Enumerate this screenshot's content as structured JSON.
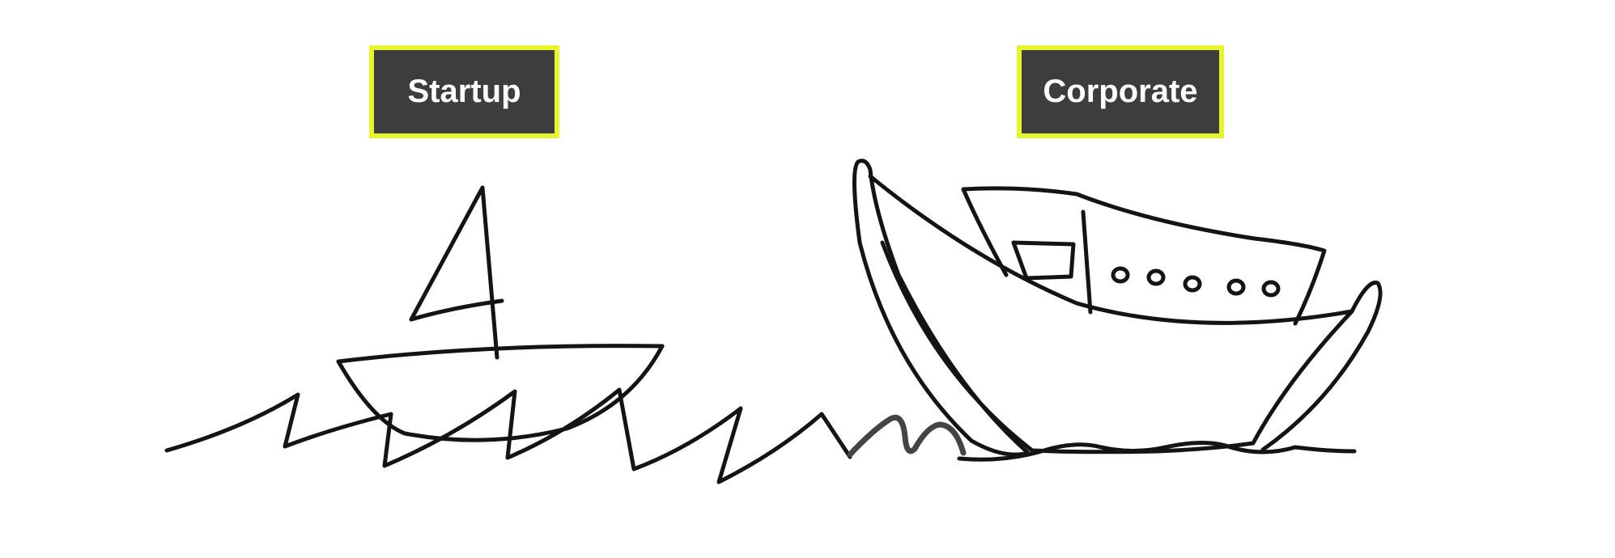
{
  "labels": {
    "startup": "Startup",
    "corporate": "Corporate"
  },
  "colors": {
    "label_background": "#3d3d3d",
    "label_border": "#e6f52e",
    "label_text": "#ffffff",
    "ink": "#141414"
  }
}
